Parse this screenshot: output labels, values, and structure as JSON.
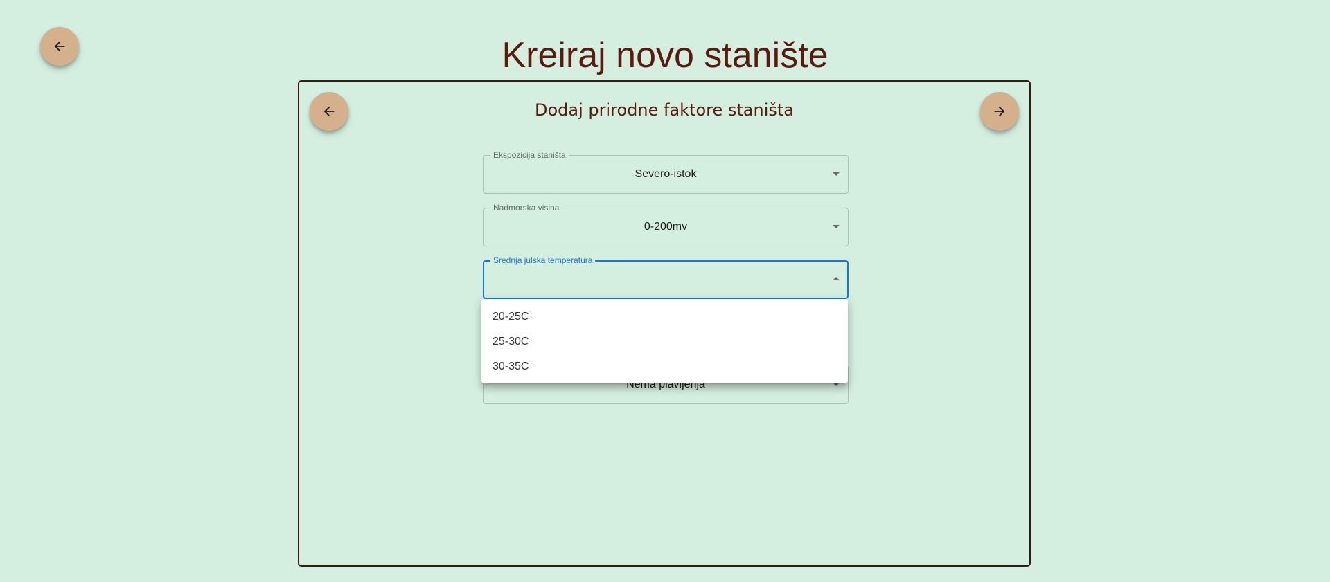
{
  "header": {
    "title": "Kreiraj novo stanište"
  },
  "card": {
    "title": "Dodaj prirodne faktore staništa"
  },
  "fields": [
    {
      "label": "Ekspozicija staništa",
      "value": "Severo-istok"
    },
    {
      "label": "Nadmorska visina",
      "value": "0-200mv"
    },
    {
      "label": "Srednja julska temperatura",
      "value": ""
    },
    {
      "label": "",
      "value": "Nema plavljenja"
    }
  ],
  "dropdown": {
    "options": [
      "20-25C",
      "25-30C",
      "30-35C"
    ]
  },
  "colors": {
    "background": "#d4efe0",
    "title": "#5c1a0f",
    "fab": "#d4b08c",
    "focus": "#1976d2"
  },
  "icons": {
    "back": "arrow-left-icon",
    "next": "arrow-right-icon"
  }
}
